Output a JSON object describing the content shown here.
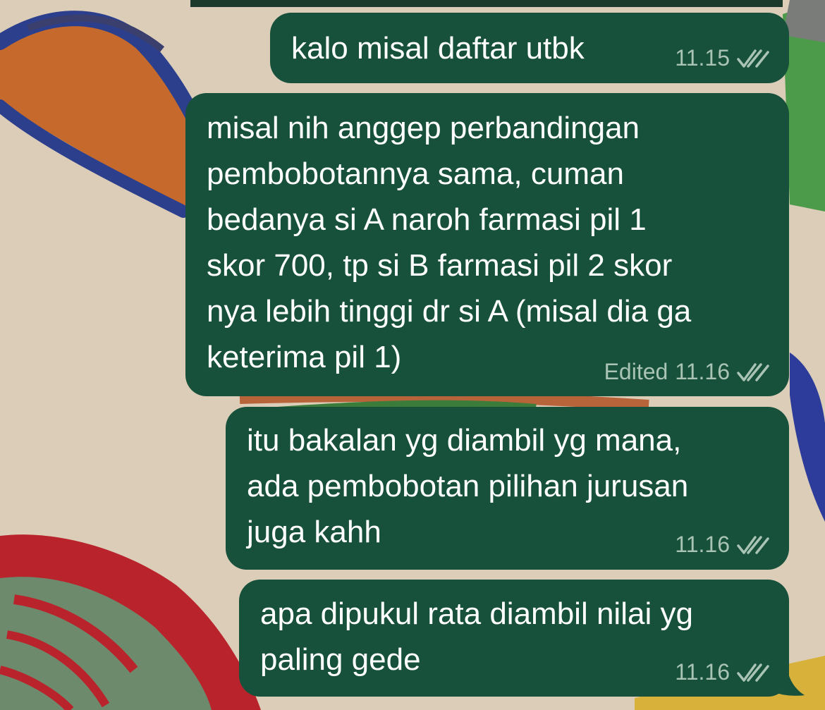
{
  "theme": {
    "bubble_color": "#17513b",
    "text_color": "#ffffff",
    "meta_color": "#a9c3b5"
  },
  "messages": [
    {
      "direction": "outgoing",
      "text": "kalo misal daftar utbk",
      "edited_label": "",
      "time": "11.15",
      "status_icon": "double-check-icon"
    },
    {
      "direction": "outgoing",
      "text": "misal nih anggep perbandingan\npembobotannya sama, cuman\nbedanya si A naroh farmasi pil 1\nskor 700, tp si B farmasi pil 2 skor\nnya lebih tinggi dr si A (misal dia ga\nketerima pil 1)",
      "edited_label": "Edited",
      "time": "11.16",
      "status_icon": "double-check-icon"
    },
    {
      "direction": "outgoing",
      "text": "itu bakalan yg diambil yg mana,\nada pembobotan pilihan jurusan\njuga kahh",
      "edited_label": "",
      "time": "11.16",
      "status_icon": "double-check-icon"
    },
    {
      "direction": "outgoing",
      "text": "apa dipukul rata diambil nilai yg\npaling gede",
      "edited_label": "",
      "time": "11.16",
      "status_icon": "double-check-icon"
    }
  ]
}
